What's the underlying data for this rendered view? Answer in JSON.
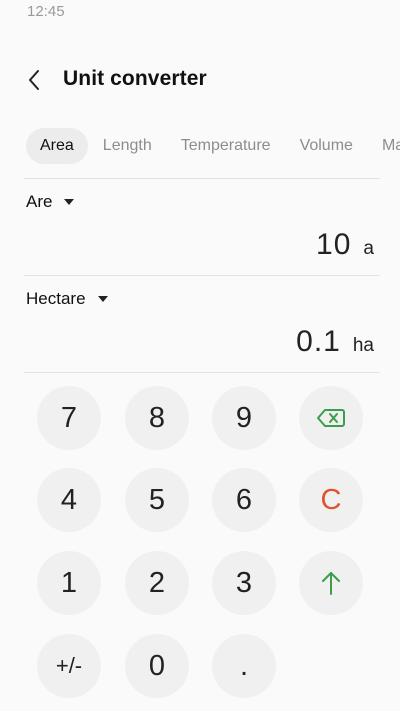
{
  "status_bar": {
    "time": "12:45"
  },
  "app_bar": {
    "title": "Unit converter",
    "back_icon": "chevron-left-icon"
  },
  "tabs": [
    {
      "label": "Area",
      "active": true
    },
    {
      "label": "Length",
      "active": false
    },
    {
      "label": "Temperature",
      "active": false
    },
    {
      "label": "Volume",
      "active": false
    },
    {
      "label": "Ma",
      "active": false
    }
  ],
  "from": {
    "unit_name": "Are",
    "value": "10",
    "unit_symbol": "a"
  },
  "to": {
    "unit_name": "Hectare",
    "value": "0.1",
    "unit_symbol": "ha"
  },
  "keypad": {
    "keys": [
      "7",
      "8",
      "9",
      "4",
      "5",
      "6",
      "1",
      "2",
      "3",
      "+/-",
      "0",
      "."
    ],
    "clear_label": "C",
    "backspace_icon": "backspace-icon",
    "swap_icon": "arrow-up-icon"
  },
  "colors": {
    "accent_green": "#3a9e4a",
    "clear_red": "#e5502f",
    "key_bg": "#f0f0f0"
  }
}
